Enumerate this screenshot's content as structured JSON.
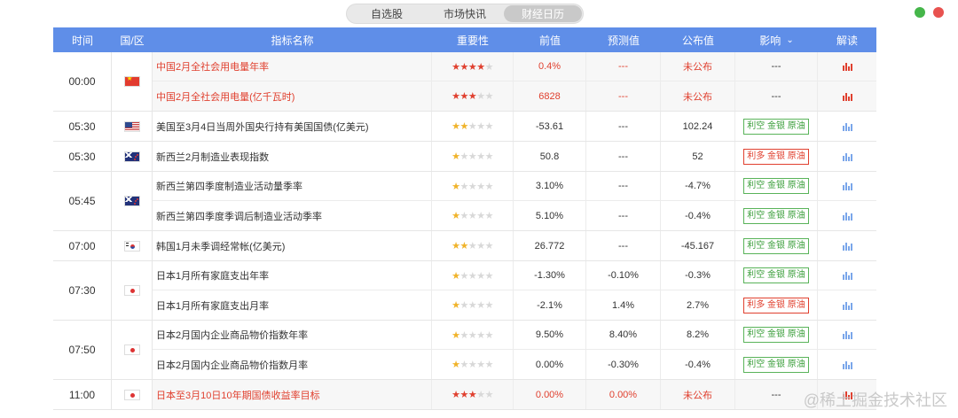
{
  "tabs": [
    "自选股",
    "市场快讯",
    "财经日历"
  ],
  "header": [
    "时间",
    "国/区",
    "指标名称",
    "重要性",
    "前值",
    "预测值",
    "公布值",
    "影响",
    "解读"
  ],
  "groups": [
    {
      "time": "00:00",
      "flag": "cn",
      "rows": [
        {
          "name": "中国2月全社会用电量年率",
          "stars": 4,
          "prev": "0.4%",
          "fore": "---",
          "pub": "未公布",
          "effect": "---",
          "hl": true
        },
        {
          "name": "中国2月全社会用电量(亿千瓦时)",
          "stars": 3,
          "prev": "6828",
          "fore": "---",
          "pub": "未公布",
          "effect": "---",
          "hl": true
        }
      ]
    },
    {
      "time": "05:30",
      "flag": "us",
      "rows": [
        {
          "name": "美国至3月4日当周外国央行持有美国国债(亿美元)",
          "stars": 2,
          "prev": "-53.61",
          "fore": "---",
          "pub": "102.24",
          "effect": "利空 金银 原油",
          "etype": "g"
        }
      ]
    },
    {
      "time": "05:30",
      "flag": "nz",
      "rows": [
        {
          "name": "新西兰2月制造业表现指数",
          "stars": 1,
          "prev": "50.8",
          "fore": "---",
          "pub": "52",
          "effect": "利多 金银 原油",
          "etype": "r"
        }
      ]
    },
    {
      "time": "05:45",
      "flag": "nz",
      "rows": [
        {
          "name": "新西兰第四季度制造业活动量季率",
          "stars": 1,
          "prev": "3.10%",
          "fore": "---",
          "pub": "-4.7%",
          "effect": "利空 金银 原油",
          "etype": "g"
        },
        {
          "name": "新西兰第四季度季调后制造业活动季率",
          "stars": 1,
          "prev": "5.10%",
          "fore": "---",
          "pub": "-0.4%",
          "effect": "利空 金银 原油",
          "etype": "g"
        }
      ]
    },
    {
      "time": "07:00",
      "flag": "kr",
      "rows": [
        {
          "name": "韩国1月未季调经常帐(亿美元)",
          "stars": 2,
          "prev": "26.772",
          "fore": "---",
          "pub": "-45.167",
          "effect": "利空 金银 原油",
          "etype": "g"
        }
      ]
    },
    {
      "time": "07:30",
      "flag": "jp",
      "rows": [
        {
          "name": "日本1月所有家庭支出年率",
          "stars": 1,
          "prev": "-1.30%",
          "fore": "-0.10%",
          "pub": "-0.3%",
          "effect": "利空 金银 原油",
          "etype": "g"
        },
        {
          "name": "日本1月所有家庭支出月率",
          "stars": 1,
          "prev": "-2.1%",
          "fore": "1.4%",
          "pub": "2.7%",
          "effect": "利多 金银 原油",
          "etype": "r"
        }
      ]
    },
    {
      "time": "07:50",
      "flag": "jp",
      "rows": [
        {
          "name": "日本2月国内企业商品物价指数年率",
          "stars": 1,
          "prev": "9.50%",
          "fore": "8.40%",
          "pub": "8.2%",
          "effect": "利空 金银 原油",
          "etype": "g"
        },
        {
          "name": "日本2月国内企业商品物价指数月率",
          "stars": 1,
          "prev": "0.00%",
          "fore": "-0.30%",
          "pub": "-0.4%",
          "effect": "利空 金银 原油",
          "etype": "g"
        }
      ]
    },
    {
      "time": "11:00",
      "flag": "jp",
      "rows": [
        {
          "name": "日本至3月10日10年期国债收益率目标",
          "stars": 3,
          "prev": "0.00%",
          "fore": "0.00%",
          "pub": "未公布",
          "effect": "---",
          "hl": true
        }
      ]
    }
  ],
  "watermark": "@稀土掘金技术社区"
}
